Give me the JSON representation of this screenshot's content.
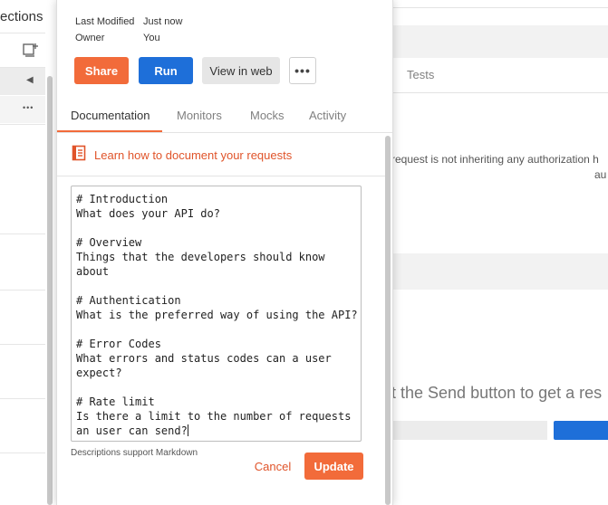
{
  "sidebar": {
    "title_fragment": "ections",
    "more_glyph": "•••",
    "collapse_glyph": "◀"
  },
  "panel": {
    "meta": [
      {
        "label": "Last Modified",
        "value": "Just now"
      },
      {
        "label": "Owner",
        "value": "You"
      }
    ],
    "buttons": {
      "share": "Share",
      "run": "Run",
      "view_web": "View in web",
      "more": "•••"
    },
    "tabs": [
      "Documentation",
      "Monitors",
      "Mocks",
      "Activity"
    ],
    "active_tab": "Documentation",
    "learn_link": "Learn how to document your requests",
    "editor_lines": [
      "# Introduction",
      "What does your API do?",
      "",
      "# Overview",
      "Things that the developers should know",
      "about",
      "",
      "# Authentication",
      "What is the preferred way of using the API?",
      "",
      "# Error Codes",
      "What errors and status codes can a user",
      "expect?",
      "",
      "# Rate limit",
      "Is there a limit to the number of requests",
      "an user can send?"
    ],
    "markdown_hint": "Descriptions support Markdown",
    "cancel": "Cancel",
    "update": "Update"
  },
  "request_area": {
    "tests_tab": "Tests",
    "auth_message": "request is not inheriting any authorization h",
    "auth_message_2": "au",
    "send_hint": "t the Send button to get a res"
  },
  "colors": {
    "accent_orange": "#f26b3a",
    "primary_blue": "#1e6fd9",
    "link_orange": "#e0542a"
  },
  "icons": [
    "new-collection-icon",
    "collapse-arrow-icon",
    "more-icon",
    "documentation-icon"
  ]
}
